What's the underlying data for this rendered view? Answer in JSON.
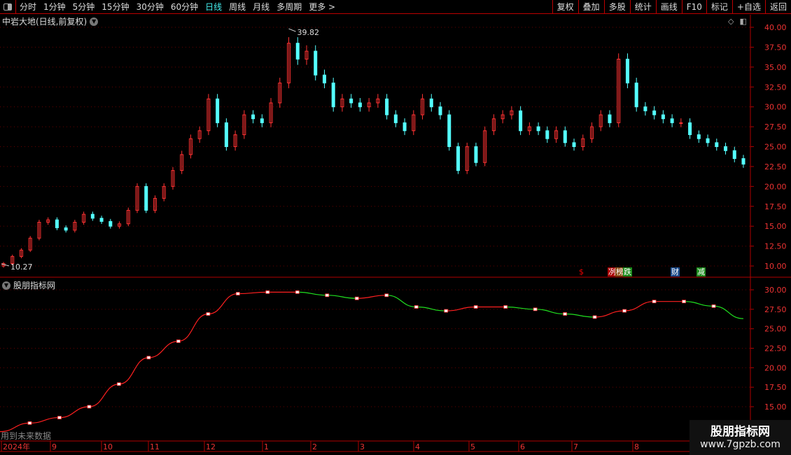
{
  "toolbar": {
    "periods": [
      "分时",
      "1分钟",
      "5分钟",
      "15分钟",
      "30分钟",
      "60分钟",
      "日线",
      "周线",
      "月线",
      "多周期",
      "更多 >"
    ],
    "active": "日线",
    "right": [
      "复权",
      "叠加",
      "多股",
      "统计",
      "画线",
      "F10",
      "标记",
      "+自选",
      "返回"
    ]
  },
  "main": {
    "title": "中岩大地(日线,前复权)",
    "max_label": "39.82",
    "min_label": "10.27",
    "y_ticks": [
      "40.00",
      "37.50",
      "35.00",
      "32.50",
      "30.00",
      "27.50",
      "25.00",
      "22.50",
      "20.00",
      "17.50",
      "15.00",
      "12.50",
      "10.00"
    ],
    "badges": [
      {
        "text": "$",
        "color": "#e00"
      },
      {
        "text": "冽",
        "color": "#a00"
      },
      {
        "text": "榜",
        "color": "#8a4a10"
      },
      {
        "text": "跌",
        "color": "#1a8a1a"
      },
      {
        "text": "财",
        "color": "#1a4a8a"
      },
      {
        "text": "减",
        "color": "#1a8a1a"
      }
    ]
  },
  "indicator": {
    "title": "股朋指标网",
    "y_ticks": [
      "30.00",
      "27.50",
      "25.00",
      "22.50",
      "20.00",
      "17.50",
      "15.00"
    ],
    "future_note": "用到未来数据"
  },
  "x_axis": {
    "labels": [
      "2024年",
      "9",
      "10",
      "11",
      "12",
      "1",
      "2",
      "3",
      "4",
      "5",
      "6",
      "7",
      "8"
    ]
  },
  "watermark": {
    "name": "股朋指标网",
    "url": "www.7gpzb.com"
  },
  "colors": {
    "up": "#ff3232",
    "down": "#54ffff",
    "ind_up": "#ff2020",
    "ind_down": "#20e020",
    "axis": "#b00000"
  },
  "chart_data": [
    {
      "type": "candlestick",
      "ylim": [
        10,
        40
      ],
      "closes": [
        10.3,
        11.2,
        12,
        13.5,
        15.5,
        15.8,
        14.8,
        14.5,
        15.5,
        16.5,
        16,
        15.6,
        15,
        15.3,
        17,
        20,
        17,
        18.5,
        20,
        22,
        24,
        26,
        27,
        31,
        28,
        25,
        26.5,
        29,
        28.5,
        28,
        30.5,
        33,
        38,
        36,
        37,
        34,
        33,
        30,
        31,
        30.5,
        30,
        30.5,
        31,
        29,
        28,
        27,
        29,
        31,
        30,
        29,
        25,
        22,
        25,
        23,
        27,
        28.5,
        29,
        29.5,
        27,
        27.5,
        27,
        26,
        27,
        25.5,
        25,
        26,
        27.5,
        29,
        28,
        36,
        33,
        30,
        29.5,
        29,
        28.5,
        28,
        28,
        26.5,
        26,
        25.5,
        25,
        24.5,
        23.5,
        22.8
      ]
    },
    {
      "type": "line",
      "ylim": [
        14,
        31
      ],
      "values": [
        11.8,
        12.9,
        13.6,
        15.0,
        17.9,
        21.3,
        23.4,
        26.9,
        29.5,
        29.7,
        29.7,
        29.3,
        28.9,
        29.3,
        27.8,
        27.3,
        27.8,
        27.8,
        27.5,
        26.9,
        26.5,
        27.3,
        28.5,
        28.5,
        27.9,
        26.3
      ]
    }
  ]
}
